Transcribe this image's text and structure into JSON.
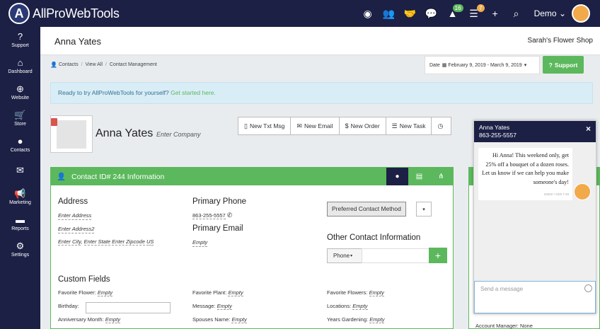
{
  "app": {
    "name": "AllProWebTools",
    "logo_letter": "A"
  },
  "topbar": {
    "icons": [
      {
        "name": "eye-icon",
        "glyph": "◉"
      },
      {
        "name": "users-icon",
        "glyph": "👥"
      },
      {
        "name": "handshake-icon",
        "glyph": "🤝"
      },
      {
        "name": "chat-icon",
        "glyph": "💬"
      },
      {
        "name": "alerts-icon",
        "glyph": "▲",
        "badge": "16",
        "badge_color": "#5cb85c"
      },
      {
        "name": "tasks-icon",
        "glyph": "☰",
        "badge": "7",
        "badge_color": "#f0ad4e"
      },
      {
        "name": "plus-icon",
        "glyph": "+"
      },
      {
        "name": "search-icon",
        "glyph": "⌕"
      }
    ],
    "user_label": "Demo"
  },
  "sidebar": {
    "items": [
      {
        "label": "Support",
        "icon": "question-icon",
        "glyph": "?"
      },
      {
        "label": "Dashboard",
        "icon": "home-icon",
        "glyph": "⌂"
      },
      {
        "label": "Website",
        "icon": "globe-icon",
        "glyph": "⊕"
      },
      {
        "label": "Store",
        "icon": "cart-icon",
        "glyph": "🛒"
      },
      {
        "label": "Contacts",
        "icon": "user-icon",
        "glyph": "●"
      },
      {
        "label": "",
        "icon": "envelope-icon",
        "glyph": "✉"
      },
      {
        "label": "Marketing",
        "icon": "megaphone-icon",
        "glyph": "📢"
      },
      {
        "label": "Reports",
        "icon": "folder-icon",
        "glyph": "▬"
      },
      {
        "label": "Settings",
        "icon": "gear-icon",
        "glyph": "⚙"
      }
    ]
  },
  "header": {
    "title": "Anna Yates",
    "shop": "Sarah's Flower Shop"
  },
  "breadcrumbs": {
    "contacts": "Contacts",
    "view_all": "View All",
    "current": "Contact Management"
  },
  "date_range": {
    "label": "Date",
    "value": "February 9, 2019 - March 9, 2019"
  },
  "support_button": "Support",
  "alert": {
    "text": "Ready to try AllProWebTools for yourself?",
    "link": "Get started here."
  },
  "contact": {
    "name": "Anna Yates",
    "company_placeholder": "Enter Company"
  },
  "actions": [
    {
      "label": "New Txt Msg",
      "icon": "mobile-icon",
      "glyph": "▯"
    },
    {
      "label": "New Email",
      "icon": "envelope-icon",
      "glyph": "✉"
    },
    {
      "label": "New Order",
      "icon": "dollar-icon",
      "glyph": "$"
    },
    {
      "label": "New Task",
      "icon": "list-icon",
      "glyph": "☰"
    },
    {
      "label": "",
      "icon": "clock-icon",
      "glyph": "◷"
    }
  ],
  "info": {
    "title": "Contact ID# 244 Information",
    "address": {
      "heading": "Address",
      "line1": "Enter Address",
      "line2": "Enter Address2",
      "city": "Enter City",
      "state": "Enter State",
      "zip": "Enter Zipcode",
      "country": "US"
    },
    "primary_phone": {
      "heading": "Primary Phone",
      "value": "863-255-5557"
    },
    "primary_email": {
      "heading": "Primary Email",
      "value": "Empty"
    },
    "preferred_contact": "Preferred Contact Method",
    "other_contact": {
      "heading": "Other Contact Information",
      "select": "Phone"
    },
    "custom_fields": {
      "heading": "Custom Fields",
      "col1": [
        {
          "label": "Favorite Flower:",
          "value": "Empty"
        },
        {
          "label": "Birthday:",
          "value": ""
        },
        {
          "label": "Anniversary Month:",
          "value": "Empty"
        }
      ],
      "col2": [
        {
          "label": "Favorite Plant:",
          "value": "Empty"
        },
        {
          "label": "Message:",
          "value": "Empty"
        },
        {
          "label": "Spouses Name:",
          "value": "Empty"
        }
      ],
      "col3": [
        {
          "label": "Favorite Flowers:",
          "value": "Empty"
        },
        {
          "label": "Locations:",
          "value": "Empty"
        },
        {
          "label": "Years Gardening:",
          "value": "Empty"
        }
      ]
    }
  },
  "account_manager": "Account Manager: None",
  "chat": {
    "name": "Anna Yates",
    "phone": "863-255-5557",
    "message": "Hi Anna! This weekend only, get 25% off a bouquet of a dozen roses. Let us know if we can help you make someone's day!",
    "timestamp": "22602 • 03/9 7:49",
    "input_placeholder": "Send a message"
  }
}
